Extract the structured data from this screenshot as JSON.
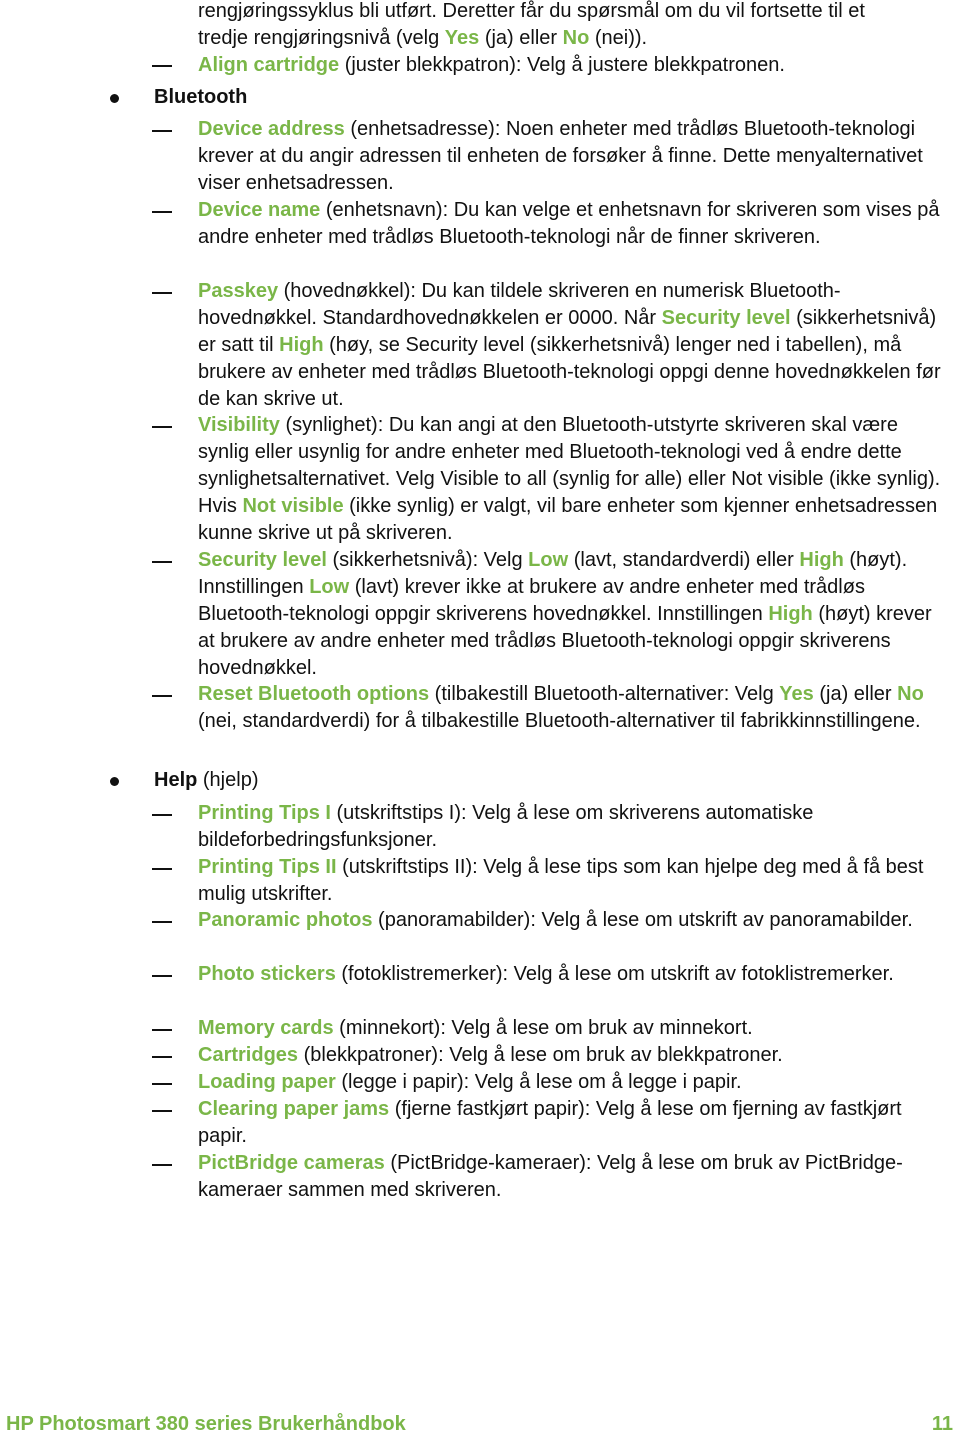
{
  "continuation": {
    "line1": "rengjøringssyklus bli utført. Deretter får du spørsmål om du vil fortsette til et",
    "line2_pre": "tredje rengjøringsnivå (velg ",
    "yes": "Yes",
    "mid": " (ja) eller ",
    "no": "No",
    "end": " (nei))."
  },
  "align": {
    "term": "Align cartridge",
    "text": " (juster blekkpatron): Velg å justere blekkpatronen."
  },
  "bluetooth": {
    "heading": "Bluetooth",
    "device_address": {
      "term": "Device address",
      "text": " (enhetsadresse): Noen enheter med trådløs Bluetooth-teknologi krever at du angir adressen til enheten de forsøker å finne. Dette menyalternativet viser enhetsadressen."
    },
    "device_name": {
      "term": "Device name",
      "text": " (enhetsnavn): Du kan velge et enhetsnavn for skriveren som vises på andre enheter med trådløs Bluetooth-teknologi når de finner skriveren."
    },
    "passkey": {
      "term": "Passkey",
      "t1": " (hovednøkkel): Du kan tildele skriveren en numerisk Bluetooth-hovednøkkel. Standardhovednøkkelen er 0000. Når ",
      "security_level": "Security level",
      "t2": " (sikkerhetsnivå) er satt til ",
      "high": "High",
      "t3": " (høy, se Security level (sikkerhetsnivå) lenger ned i tabellen), må brukere av enheter med trådløs Bluetooth-teknologi oppgi denne hovednøkkelen før de kan skrive ut."
    },
    "visibility": {
      "term": "Visibility",
      "t1": " (synlighet): Du kan angi at den Bluetooth-utstyrte skriveren skal være synlig eller usynlig for andre enheter med Bluetooth-teknologi ved å endre dette synlighetsalternativet. Velg Visible to all (synlig for alle) eller Not visible (ikke synlig). Hvis ",
      "not_visible": "Not visible",
      "t2": " (ikke synlig) er valgt, vil bare enheter som kjenner enhetsadressen kunne skrive ut på skriveren."
    },
    "security": {
      "term": "Security level",
      "t1": " (sikkerhetsnivå): Velg ",
      "low": "Low",
      "t2": " (lavt, standardverdi) eller ",
      "high": "High",
      "t3": " (høyt). Innstillingen ",
      "low2": "Low",
      "t4": " (lavt) krever ikke at brukere av andre enheter med trådløs Bluetooth-teknologi oppgir skriverens hovednøkkel. Innstillingen ",
      "high2": "High",
      "t5": " (høyt) krever at brukere av andre enheter med trådløs Bluetooth-teknologi oppgir skriverens hovednøkkel."
    },
    "reset": {
      "term": "Reset Bluetooth options",
      "t1": " (tilbakestill Bluetooth-alternativer: Velg ",
      "yes": "Yes",
      "t2": " (ja) eller ",
      "no": "No",
      "t3": " (nei, standardverdi) for å tilbakestille Bluetooth-alternativer til fabrikkinnstillingene."
    }
  },
  "help": {
    "heading": "Help",
    "heading_sub": " (hjelp)",
    "items": [
      {
        "term": "Printing Tips I",
        "text": " (utskriftstips I): Velg å lese om skriverens automatiske bildeforbedringsfunksjoner."
      },
      {
        "term": "Printing Tips II",
        "text": " (utskriftstips II): Velg å lese tips som kan hjelpe deg med å få best mulig utskrifter."
      },
      {
        "term": "Panoramic photos",
        "text": " (panoramabilder): Velg å lese om utskrift av panoramabilder."
      },
      {
        "term": "Photo stickers",
        "text": " (fotoklistremerker): Velg å lese om utskrift av fotoklistremerker."
      },
      {
        "term": "Memory cards",
        "text": " (minnekort): Velg å lese om bruk av minnekort."
      },
      {
        "term": "Cartridges",
        "text": " (blekkpatroner): Velg å lese om bruk av blekkpatroner."
      },
      {
        "term": "Loading paper",
        "text": " (legge i papir): Velg å lese om å legge i papir."
      },
      {
        "term": "Clearing paper jams",
        "text": " (fjerne fastkjørt papir): Velg å lese om fjerning av fastkjørt papir."
      },
      {
        "term": "PictBridge cameras",
        "text": " (PictBridge-kameraer): Velg å lese om bruk av PictBridge-kameraer sammen med skriveren."
      }
    ]
  },
  "footer": {
    "title": "HP Photosmart 380 series Brukerhåndbok",
    "page": "11"
  },
  "colors": {
    "accent": "#7ab648",
    "text": "#111111"
  }
}
